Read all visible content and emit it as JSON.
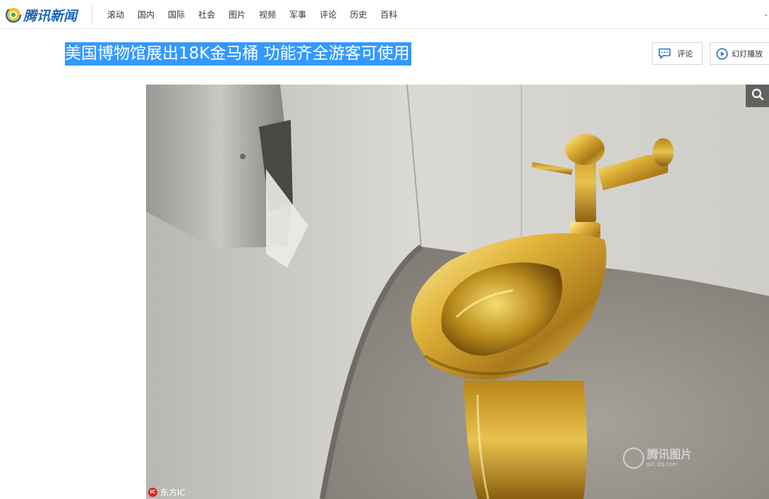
{
  "header": {
    "logo_text": "腾讯新闻",
    "nav": [
      "滚动",
      "国内",
      "国际",
      "社会",
      "图片",
      "视频",
      "军事",
      "评论",
      "历史",
      "百科"
    ],
    "edge_glyph": "-"
  },
  "article": {
    "title": "美国博物馆展出18K金马桶 功能齐全游客可使用"
  },
  "toolbar": {
    "comment_label": "评论",
    "slideshow_label": "幻灯播放"
  },
  "photo": {
    "credit": "东方IC",
    "credit_badge": "IC",
    "watermark_main": "腾讯图片",
    "watermark_sub": "pic.qq.com"
  },
  "colors": {
    "title_highlight": "#3399ff",
    "logo_blue": "#1e61b5",
    "gold": "#d4a82a"
  },
  "icons": [
    "tencent-logo-icon",
    "comment-icon",
    "play-icon",
    "search-icon"
  ]
}
